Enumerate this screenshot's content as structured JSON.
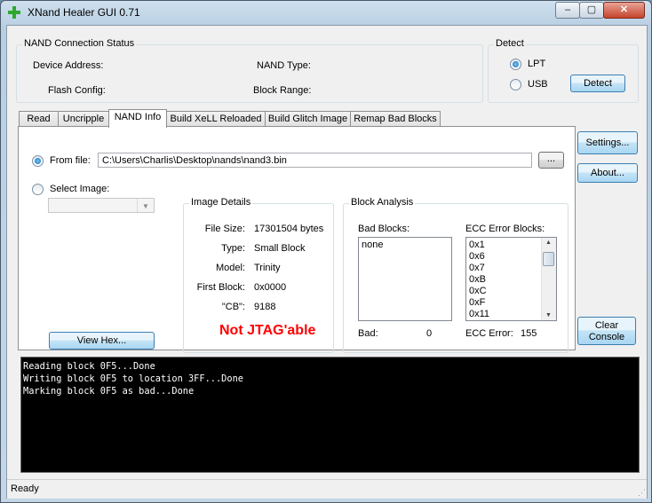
{
  "window": {
    "title": "XNand Healer GUI 0.71",
    "minimize_label": "–",
    "maximize_label": "▢",
    "close_label": "✕"
  },
  "nand_status": {
    "title": "NAND Connection Status",
    "device_address_label": "Device Address:",
    "nand_type_label": "NAND Type:",
    "flash_config_label": "Flash Config:",
    "block_range_label": "Block Range:"
  },
  "detect": {
    "title": "Detect",
    "lpt_label": "LPT",
    "usb_label": "USB",
    "selected": "LPT",
    "detect_button": "Detect"
  },
  "tabs": [
    {
      "label": "Read"
    },
    {
      "label": "Uncripple"
    },
    {
      "label": "NAND Info"
    },
    {
      "label": "Build XeLL Reloaded"
    },
    {
      "label": "Build Glitch Image"
    },
    {
      "label": "Remap Bad Blocks"
    }
  ],
  "active_tab": "NAND Info",
  "nand_info": {
    "from_file_label": "From file:",
    "file_path": "C:\\Users\\Charlis\\Desktop\\nands\\nand3.bin",
    "browse_label": "...",
    "select_image_label": "Select Image:",
    "view_hex_button": "View Hex...",
    "image_details": {
      "title": "Image Details",
      "rows": [
        {
          "label": "File Size:",
          "value": "17301504 bytes"
        },
        {
          "label": "Type:",
          "value": "Small Block"
        },
        {
          "label": "Model:",
          "value": "Trinity"
        },
        {
          "label": "First Block:",
          "value": "0x0000"
        },
        {
          "label": "\"CB\":",
          "value": "9188"
        }
      ],
      "jtag_status": "Not JTAG'able"
    },
    "block_analysis": {
      "title": "Block Analysis",
      "bad_blocks_label": "Bad Blocks:",
      "bad_blocks": [
        "none"
      ],
      "ecc_label": "ECC Error Blocks:",
      "ecc_blocks": [
        "0x1",
        "0x6",
        "0x7",
        "0xB",
        "0xC",
        "0xF",
        "0x11"
      ],
      "bad_count_label": "Bad:",
      "bad_count": "0",
      "ecc_count_label": "ECC Error:",
      "ecc_count": "155"
    }
  },
  "side_buttons": {
    "settings": "Settings...",
    "about": "About...",
    "clear_console_1": "Clear",
    "clear_console_2": "Console"
  },
  "console_lines": [
    "Reading block 0F5...Done",
    "Writing block 0F5 to location 3FF...Done",
    "Marking block 0F5 as bad...Done"
  ],
  "status": "Ready",
  "colors": {
    "jtag_status": "#ff0000",
    "console_bg": "#000000",
    "console_text": "#ffffff"
  }
}
